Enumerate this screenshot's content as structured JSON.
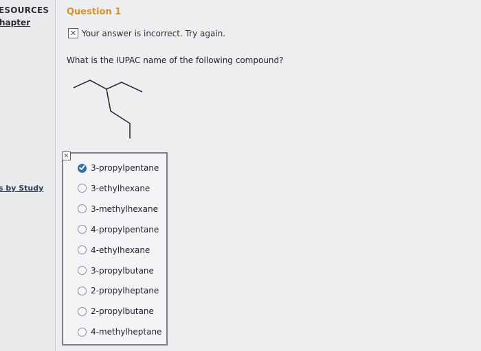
{
  "sidebar": {
    "resources_label": "ESOURCES",
    "chapter_label": "hapter",
    "by_study_label": "s by Study"
  },
  "question": {
    "title": "Question 1",
    "feedback": "Your answer is incorrect.  Try again.",
    "prompt": "What is the IUPAC name of the following compound?"
  },
  "options": [
    {
      "label": "3-propylpentane",
      "selected": true
    },
    {
      "label": "3-ethylhexane",
      "selected": false
    },
    {
      "label": "3-methylhexane",
      "selected": false
    },
    {
      "label": "4-propylpentane",
      "selected": false
    },
    {
      "label": "4-ethylhexane",
      "selected": false
    },
    {
      "label": "3-propylbutane",
      "selected": false
    },
    {
      "label": "2-propylheptane",
      "selected": false
    },
    {
      "label": "2-propylbutane",
      "selected": false
    },
    {
      "label": "4-methylheptane",
      "selected": false
    }
  ],
  "colors": {
    "accent": "#2f6fb0",
    "question_title": "#d9902b"
  },
  "icons": {
    "feedback": "incorrect-x-icon",
    "selected_radio": "checkmark"
  }
}
